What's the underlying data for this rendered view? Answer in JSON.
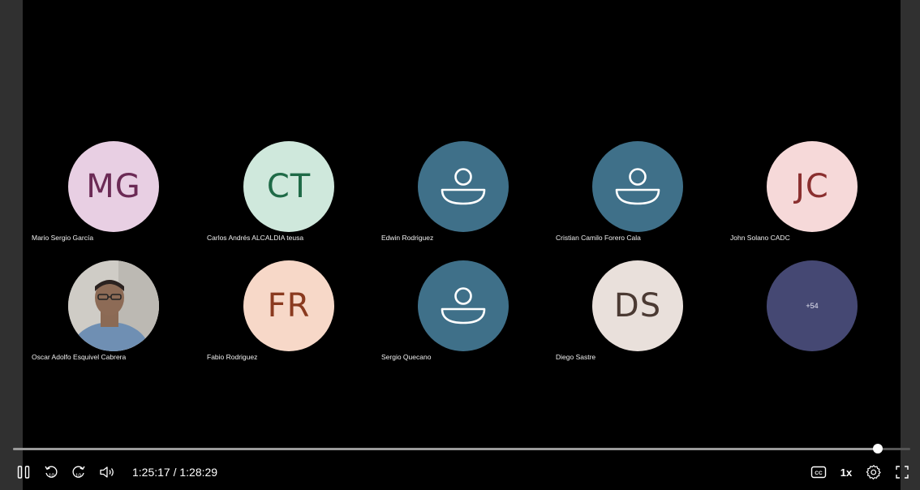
{
  "participants_row1": [
    {
      "initials": "MG",
      "name": "Mario Sergio García",
      "bg": "#e8cfe3",
      "fg": "#6b2a55"
    },
    {
      "initials": "CT",
      "name": "Carlos Andrés ALCALDIA teusa",
      "bg": "#cfe8dc",
      "fg": "#1f6a47"
    },
    {
      "initials": "",
      "name": "Edwin Rodriguez",
      "bg": "#3f7089",
      "fg": "#ffffff",
      "icon": "person-icon"
    },
    {
      "initials": "",
      "name": "Cristian Camilo Forero Cala",
      "bg": "#3f7089",
      "fg": "#ffffff",
      "icon": "person-icon"
    },
    {
      "initials": "JC",
      "name": "John Solano CADC",
      "bg": "#f6d9d9",
      "fg": "#8a2f2f"
    }
  ],
  "participants_row2": [
    {
      "initials": "",
      "name": "Oscar Adolfo Esquivel Cabrera",
      "photo": true
    },
    {
      "initials": "FR",
      "name": "Fabio Rodriguez",
      "bg": "#f7d8c8",
      "fg": "#8a3a1f"
    },
    {
      "initials": "",
      "name": "Sergio Quecano",
      "bg": "#3f7089",
      "fg": "#ffffff",
      "icon": "person-icon"
    },
    {
      "initials": "DS",
      "name": "Diego Sastre",
      "bg": "#e9e0db",
      "fg": "#4b3a33"
    },
    {
      "more": "+54",
      "bg": "#454873",
      "fg": "#e8e8f5"
    }
  ],
  "player": {
    "current_time": "1:25:17",
    "duration": "1:28:29",
    "time_display": "1:25:17 / 1:28:29",
    "progress": 0.964,
    "speed": "1x",
    "skip_back_seconds": "10",
    "skip_forward_seconds": "10"
  },
  "icons": {
    "pause": "pause-icon",
    "rewind": "rewind-10-icon",
    "forward": "forward-10-icon",
    "volume": "volume-icon",
    "captions": "captions-icon",
    "settings": "gear-icon",
    "fullscreen": "fullscreen-icon"
  }
}
